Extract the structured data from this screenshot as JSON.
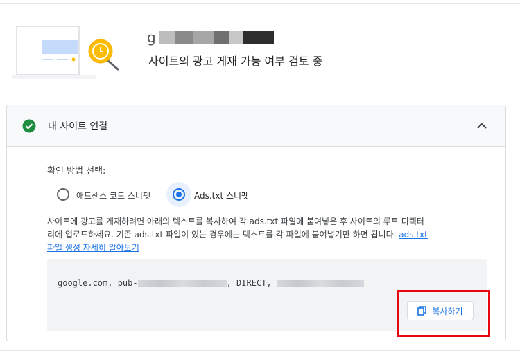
{
  "header": {
    "site_name_visible": "g",
    "status": "사이트의 광고 게재 가능 여부 검토 중"
  },
  "card": {
    "title": "내 사이트 연결",
    "status_color": "#1e8e3e",
    "choose_label": "확인 방법 선택:",
    "options": [
      {
        "label": "애드센스 코드 스니펫",
        "selected": false
      },
      {
        "label": "Ads.txt 스니펫",
        "selected": true
      }
    ],
    "description_lines": [
      "사이트에 광고를 게재하려면 아래의 텍스트를 복사하여 각 ads.txt 파일에 붙여넣은 후 사이트의 루트 디렉터",
      "리에 업로드하세요. 기존 ads.txt 파일이 있는 경우에는 텍스트를 각 파일에 붙여넣기만 하면 됩니다. "
    ],
    "learn_more_link_a": "ads.txt",
    "learn_more_link_b": "파일 생성 자세히 알아보기",
    "code": {
      "part1": "google.com, pub-",
      "part2": ", DIRECT, "
    },
    "copy_button": "복사하기"
  },
  "colors": {
    "accent": "#1a73e8",
    "highlight": "#e8070e"
  }
}
